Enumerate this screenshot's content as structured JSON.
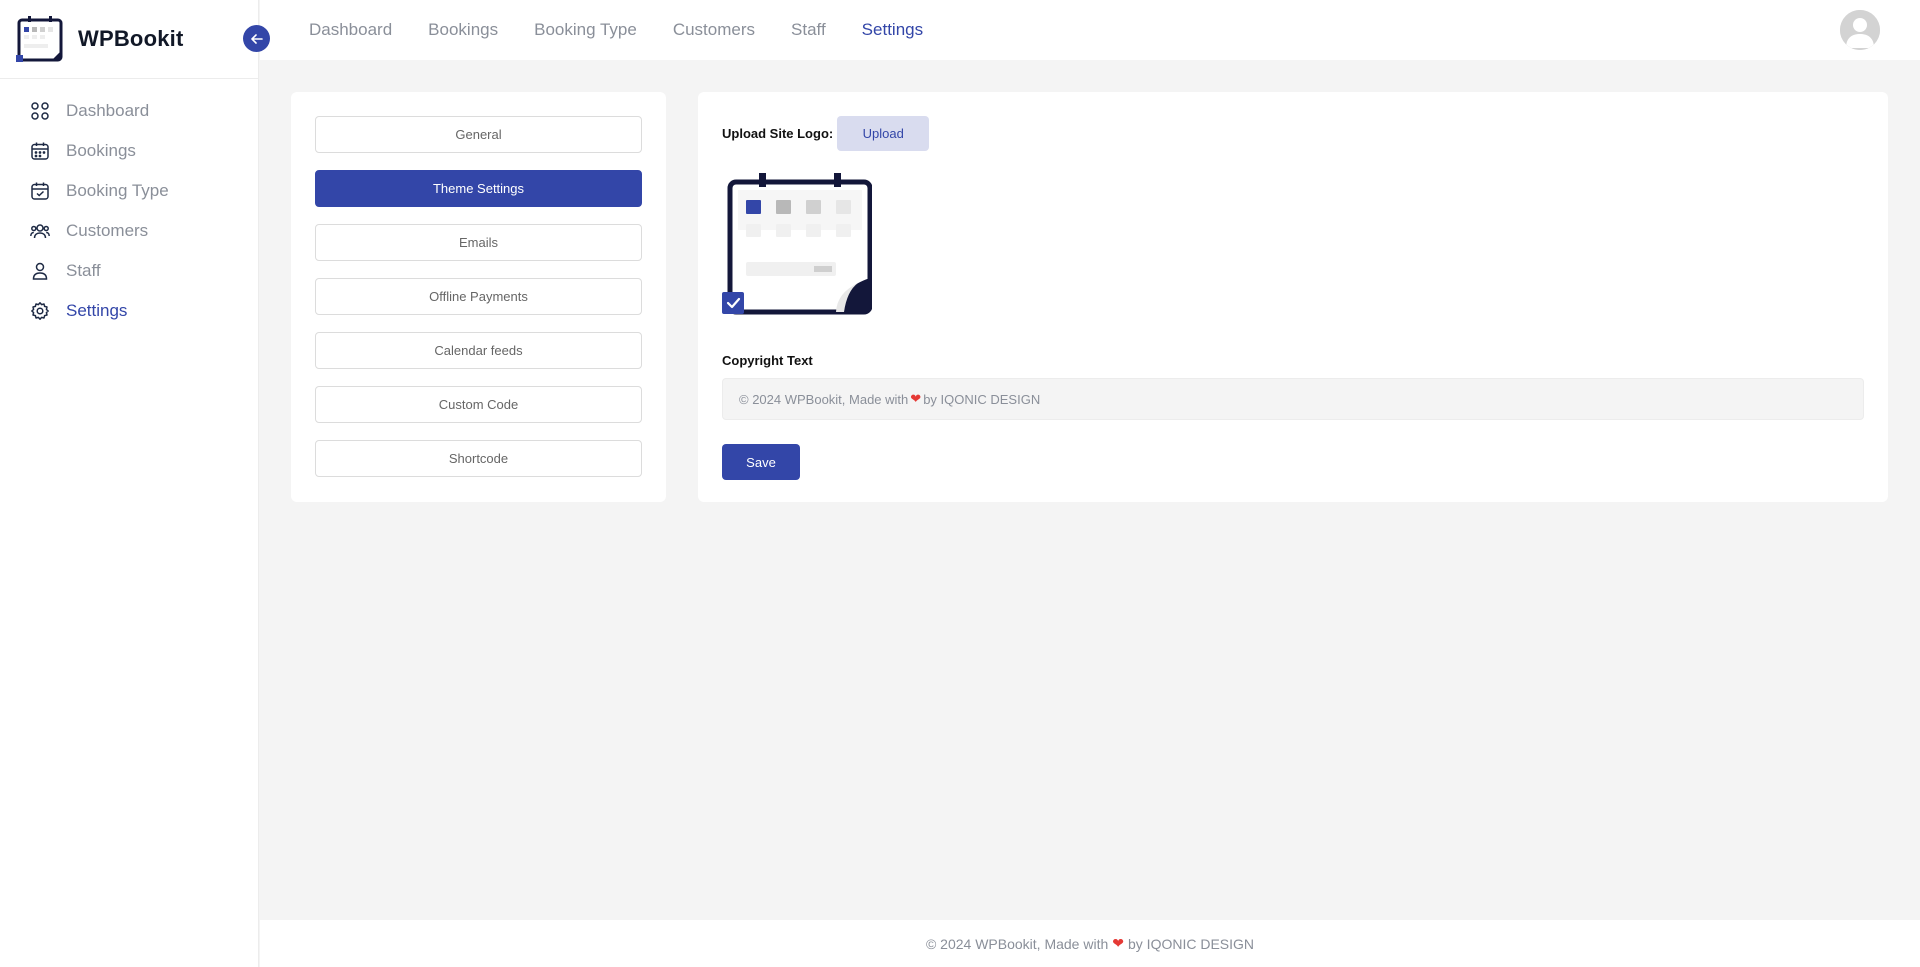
{
  "brand": {
    "name": "WPBookit"
  },
  "sidebar": {
    "items": [
      {
        "label": "Dashboard",
        "icon": "grid-icon"
      },
      {
        "label": "Bookings",
        "icon": "calendar-icon"
      },
      {
        "label": "Booking Type",
        "icon": "calendar-check-icon"
      },
      {
        "label": "Customers",
        "icon": "users-icon"
      },
      {
        "label": "Staff",
        "icon": "user-icon"
      },
      {
        "label": "Settings",
        "icon": "gear-icon",
        "active": true
      }
    ]
  },
  "topnav": {
    "items": [
      "Dashboard",
      "Bookings",
      "Booking Type",
      "Customers",
      "Staff",
      "Settings"
    ],
    "active": "Settings"
  },
  "settings_menu": {
    "items": [
      "General",
      "Theme Settings",
      "Emails",
      "Offline Payments",
      "Calendar feeds",
      "Custom Code",
      "Shortcode"
    ],
    "active": "Theme Settings"
  },
  "theme_settings": {
    "upload_label": "Upload Site Logo:",
    "upload_button": "Upload",
    "copyright_label": "Copyright Text",
    "copyright_prefix": "© 2024 WPBookit, Made with",
    "copyright_suffix": "by IQONIC DESIGN",
    "save_button": "Save"
  },
  "footer": {
    "prefix": "© 2024 WPBookit, Made with",
    "suffix": "by IQONIC DESIGN"
  },
  "colors": {
    "primary": "#3346a8",
    "muted_text": "#8a8f99",
    "background": "#f4f4f4",
    "heart": "#e53935"
  }
}
